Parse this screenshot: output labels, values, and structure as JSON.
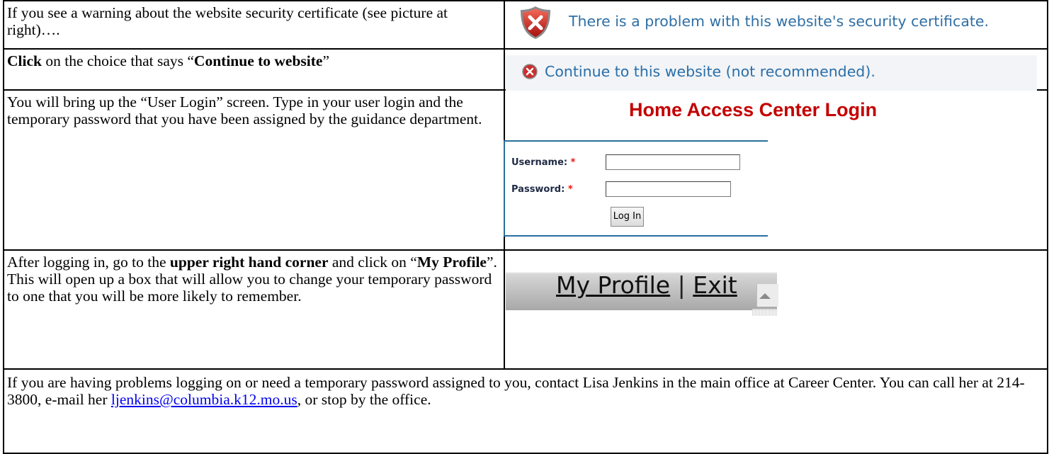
{
  "rows": [
    {
      "left_text": "If you see a warning about the website security certificate (see picture at right)….",
      "cert_warning_text": "There is a problem with this website's security certificate."
    },
    {
      "left_pre": "Click",
      "left_mid": " on the choice that says “",
      "left_bold": "Continue to website",
      "left_post": "”",
      "continue_text": "Continue to this website (not recommended)."
    },
    {
      "left_text": "You will bring up the “User Login” screen. Type in your user login and the temporary password that you have been assigned by the guidance department.",
      "login_title": "Home Access Center Login",
      "username_label": "Username:",
      "password_label": "Password:",
      "required_mark": "*",
      "login_button": "Log In"
    },
    {
      "left_a": "After logging in, go to the ",
      "left_b": "upper right hand corner",
      "left_c": " and click on “",
      "left_d": "My Profile",
      "left_e": "”. This will open up a box that will allow you to change your temporary password to one that you will be more likely to remember.",
      "menu_profile": "My Profile",
      "menu_sep": "|",
      "menu_exit": "Exit"
    }
  ],
  "footer": {
    "text_before": "If you are having problems logging on or need a temporary password assigned to you, contact Lisa Jenkins in the main office at Career Center. You can call her at 214-3800, e-mail her ",
    "email": "ljenkins@columbia.k12.mo.us",
    "text_after": ", or stop by the office."
  },
  "colors": {
    "border": "#000000",
    "cert_text": "#2f6fa5",
    "login_title": "#c40000",
    "login_box_border": "#2a6f9e",
    "link": "#0000ee"
  }
}
